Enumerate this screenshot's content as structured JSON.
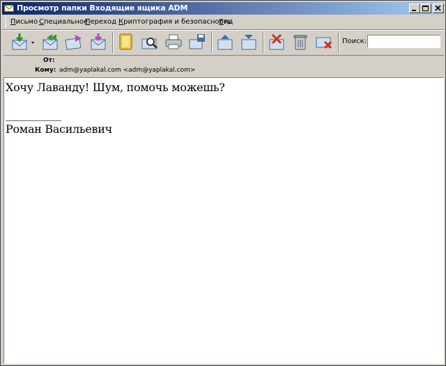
{
  "window": {
    "title": "Просмотр папки Входящие ящика ADM"
  },
  "menu": [
    "Письмо",
    "Специальное",
    "Переход",
    "Криптография и безопасность",
    "Вид"
  ],
  "toolbar": {
    "buttons": [
      "get-mail",
      "reply-all",
      "forward",
      "send-receive",
      "address-book",
      "find",
      "print",
      "save",
      "previous",
      "next",
      "mark-spam",
      "delete",
      "delete-block"
    ],
    "search_label": "Поиск:",
    "search_value": ""
  },
  "header": {
    "from_label": "От:",
    "from_value": "",
    "to_label": "Кому:",
    "to_value": "adm@yaplakal.com <adm@yaplakal.com>"
  },
  "message": {
    "line1": "Хочу Лаванду! Шум, помочь можешь?",
    "signature_separator": "__________",
    "signature": "Роман Васильевич"
  },
  "colors": {
    "titlebar_start": "#0a246a",
    "titlebar_end": "#a6caf0",
    "window_bg": "#d4d0c8",
    "body_bg": "#ffffff"
  }
}
